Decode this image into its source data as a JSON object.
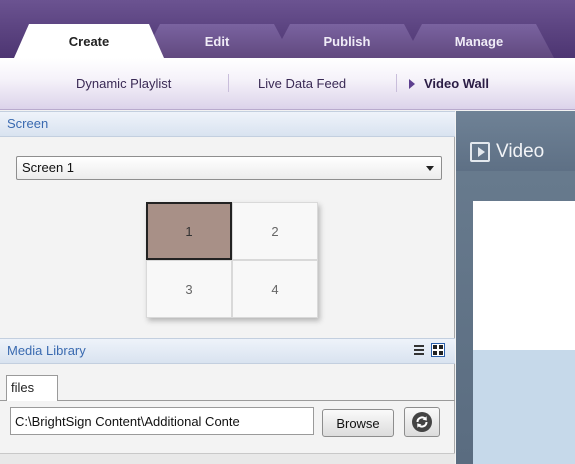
{
  "tabs": [
    {
      "label": "Create",
      "active": true
    },
    {
      "label": "Edit",
      "active": false
    },
    {
      "label": "Publish",
      "active": false
    },
    {
      "label": "Manage",
      "active": false
    }
  ],
  "subnav": {
    "items": [
      "Dynamic Playlist",
      "Live Data Feed",
      "Video Wall"
    ],
    "active": "Video Wall"
  },
  "screen_section": {
    "header": "Screen",
    "select_value": "Screen 1",
    "cells": [
      "1",
      "2",
      "3",
      "4"
    ],
    "selected_cell": "1"
  },
  "media_library": {
    "header": "Media Library",
    "tab_label": "files",
    "path_value": "C:\\BrightSign Content\\Additional Conte",
    "browse_label": "Browse"
  },
  "preview": {
    "title": "Video"
  },
  "icons": {
    "list_view": "list-view-icon",
    "grid_view": "grid-view-icon",
    "refresh": "refresh-icon",
    "play": "play-icon",
    "dropdown": "chevron-down-icon"
  },
  "colors": {
    "tabbar": "#5a427f",
    "selected_cell": "#a89087",
    "section_header_text": "#3a6ab0",
    "preview_bg": "#6a7d90"
  }
}
